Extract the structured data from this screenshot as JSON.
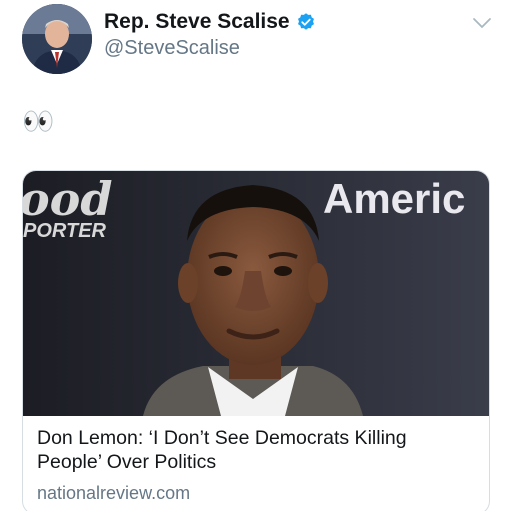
{
  "tweet": {
    "author": {
      "display_name": "Rep. Steve Scalise",
      "handle": "@SteveScalise",
      "verified": true,
      "avatar_icon": "profile-photo"
    },
    "text": "👀",
    "menu_icon": "chevron-down-icon"
  },
  "card": {
    "image_backdrop_text_left": "ood",
    "image_backdrop_text_left_sub": "PORTER",
    "image_backdrop_text_right": "Americ",
    "title_line1": "Don Lemon: ‘I Don’t See Democrats Killing",
    "title_line2": "People’ Over Politics",
    "domain": "nationalreview.com"
  },
  "colors": {
    "verified_blue": "#1da1f2",
    "secondary_text": "#657786",
    "border": "#d6dde3"
  }
}
